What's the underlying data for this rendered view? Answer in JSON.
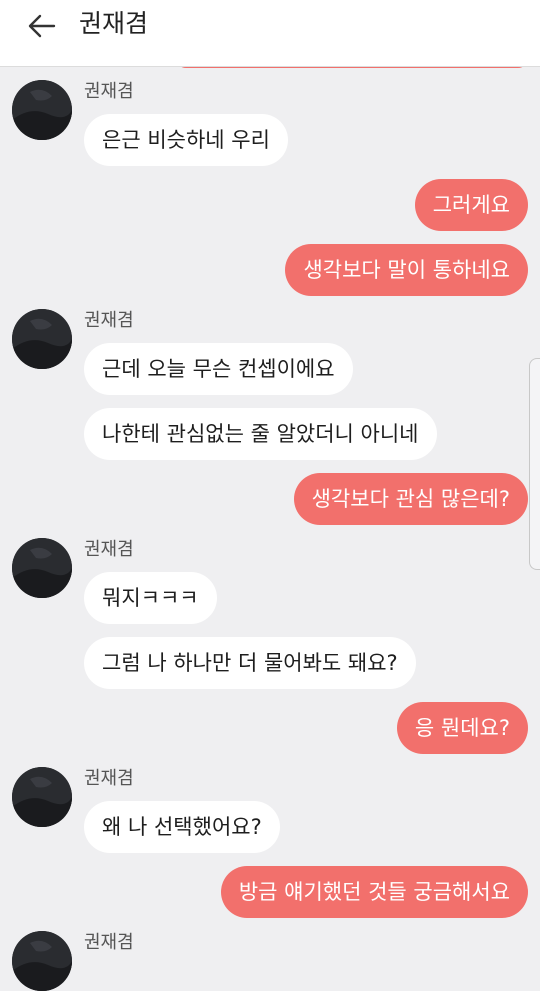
{
  "header": {
    "title": "권재겸"
  },
  "messages": [
    {
      "type": "in",
      "text": "은근 비슷하네 우리"
    },
    {
      "type": "out",
      "text": "그러게요"
    },
    {
      "type": "out",
      "text": "생각보다 말이 통하네요"
    },
    {
      "type": "in",
      "text": "근데 오늘 무슨 컨셉이에요"
    },
    {
      "type": "in",
      "text": "나한테 관심없는 줄 알았더니 아니네"
    },
    {
      "type": "out",
      "text": "생각보다 관심 많은데?"
    },
    {
      "type": "in",
      "text": "뭐지ㅋㅋㅋ"
    },
    {
      "type": "in",
      "text": "그럼 나 하나만 더 물어봐도 돼요?"
    },
    {
      "type": "out",
      "text": "응 뭔데요?"
    },
    {
      "type": "in",
      "text": "왜 나 선택했어요?"
    },
    {
      "type": "out",
      "text": "방금 얘기했던 것들 궁금해서요"
    }
  ],
  "senders": [
    "권재겸",
    "권재겸",
    "권재겸",
    "권재겸",
    "권재겸"
  ],
  "colors": {
    "outgoing_bubble": "#f2706c",
    "incoming_bubble": "#ffffff",
    "background": "#efeff1"
  },
  "icons": {
    "back": "arrow-left-icon",
    "avatar": "profile-photo"
  }
}
